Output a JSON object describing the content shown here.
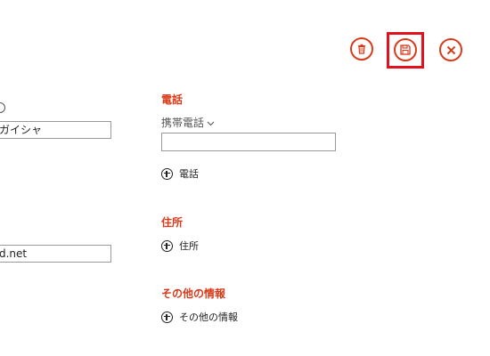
{
  "toolbar": {
    "delete_icon": "trash-icon",
    "save_icon": "floppy-disk-icon",
    "cancel_icon": "close-icon",
    "accent": "#d83b1a",
    "highlight": "#e1111d"
  },
  "left_column": {
    "field1_value": "ガイシャ",
    "field2_value": "d.net"
  },
  "phone": {
    "title": "電話",
    "type_label": "携帯電話",
    "value": "",
    "add_label": "電話"
  },
  "address": {
    "title": "住所",
    "add_label": "住所"
  },
  "other": {
    "title": "その他の情報",
    "add_label": "その他の情報"
  }
}
